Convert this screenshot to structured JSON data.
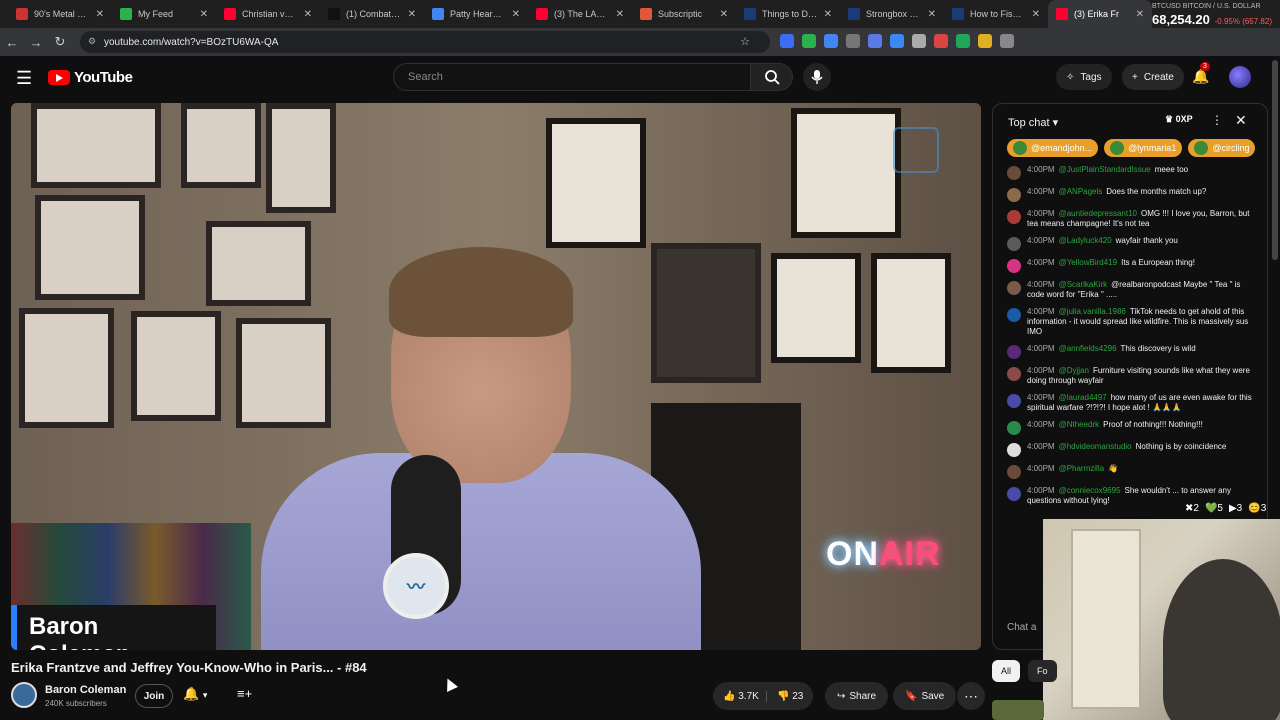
{
  "browser": {
    "tabs": [
      {
        "label": "90's Metal Clas",
        "fav_color": "#cc3333"
      },
      {
        "label": "My Feed",
        "fav_color": "#2bb24c"
      },
      {
        "label": "Christian vs Jew",
        "fav_color": "#ff0033"
      },
      {
        "label": "(1) Combat Arc",
        "fav_color": "#111111"
      },
      {
        "label": "Patty Hearst- H",
        "fav_color": "#4285f4"
      },
      {
        "label": "(3) The LAPD S",
        "fav_color": "#ff0033"
      },
      {
        "label": "Subscriptic",
        "fav_color": "#e0573b"
      },
      {
        "label": "Things to Do Fi",
        "fav_color": "#1a3a7a"
      },
      {
        "label": "Strongbox Puz",
        "fav_color": "#1a3a7a"
      },
      {
        "label": "How to Fish - C",
        "fav_color": "#1a3a7a"
      },
      {
        "label": "(3) Erika Fr",
        "fav_color": "#ff0033"
      }
    ],
    "url": "youtube.com/watch?v=BOzTU6WA-QA",
    "ticker": {
      "symbol": "BTCUSD\nBITCOIN / U.S. DOLLAR",
      "price": "68,254.20",
      "change": "-0.95% (657.82)"
    }
  },
  "youtube": {
    "logo_text": "YouTube",
    "search_placeholder": "Search",
    "tags_label": "Tags",
    "create_label": "Create",
    "notif_count": "3"
  },
  "video": {
    "lower_third": "Baron Coleman",
    "onair_on": "ON",
    "onair_air": "AIR",
    "title": "Erika Frantzve and Jeffrey You-Know-Who in Paris... - #84",
    "channel": "Baron Coleman",
    "subscribers": "240K subscribers",
    "join_label": "Join",
    "likes": "3.7K",
    "dislikes": "23",
    "share_label": "Share",
    "save_label": "Save"
  },
  "chat": {
    "header": "Top chat",
    "xp": "0XP",
    "pinned": [
      "@emandjohn...",
      "@lynmaria1",
      "@circling"
    ],
    "messages": [
      {
        "time": "4:00PM",
        "author": "@JustPlainStandardIssue",
        "text": "meee too",
        "color": "#6a4a3a"
      },
      {
        "time": "4:00PM",
        "author": "@ANPagels",
        "text": "Does the months match up?",
        "color": "#8a6a4a"
      },
      {
        "time": "4:00PM",
        "author": "@auntiedepressant10",
        "text": "OMG !!! I love you, Barron, but tea means champagne! It's not tea",
        "color": "#aa3a3a"
      },
      {
        "time": "4:00PM",
        "author": "@Ladyluck420",
        "text": "wayfair thank you",
        "color": "#5a5a5a"
      },
      {
        "time": "4:00PM",
        "author": "@YellowBird419",
        "text": "Its a European thing!",
        "color": "#d63384"
      },
      {
        "time": "4:00PM",
        "author": "@ScarlkaKirk",
        "text": "@realbaronpodcast Maybe \" Tea \" is code word for \"Erika \" .....",
        "color": "#7a5a4a"
      },
      {
        "time": "4:00PM",
        "author": "@julia.vanilla.1986",
        "text": "TikTok needs to get ahold of this information - it would spread like wildfire. This is massively sus IMO",
        "color": "#1a5aa8"
      },
      {
        "time": "4:00PM",
        "author": "@annfields4296",
        "text": "This discovery is wild",
        "color": "#5a2a7a"
      },
      {
        "time": "4:00PM",
        "author": "@Dyjjan",
        "text": "Furniture visiting sounds like what they were doing through wayfair",
        "color": "#8a4a4a"
      },
      {
        "time": "4:00PM",
        "author": "@laurad4497",
        "text": "how many of us are even awake for this spiritual warfare ?!?!?! I hope alot ! 🙏🙏🙏",
        "color": "#4a4aa8"
      },
      {
        "time": "4:00PM",
        "author": "@Ntheedrk",
        "text": "Proof of nothing!!! Nothing!!!",
        "color": "#2a8a4a"
      },
      {
        "time": "4:00PM",
        "author": "@hdvideomanstudio",
        "text": "Nothing is by coincidence",
        "color": "#dddddd"
      },
      {
        "time": "4:00PM",
        "author": "@Pharmzilla",
        "text": "👋",
        "color": "#6a4a3a"
      },
      {
        "time": "4:00PM",
        "author": "@conniecox9695",
        "text": "She wouldn't ... to answer any questions without lying!",
        "color": "#4a4aa8"
      }
    ],
    "input_placeholder": "Chat a",
    "reactions": [
      "2",
      "5",
      "3",
      "3"
    ],
    "filter_all": "All",
    "filter_fo": "Fo"
  }
}
